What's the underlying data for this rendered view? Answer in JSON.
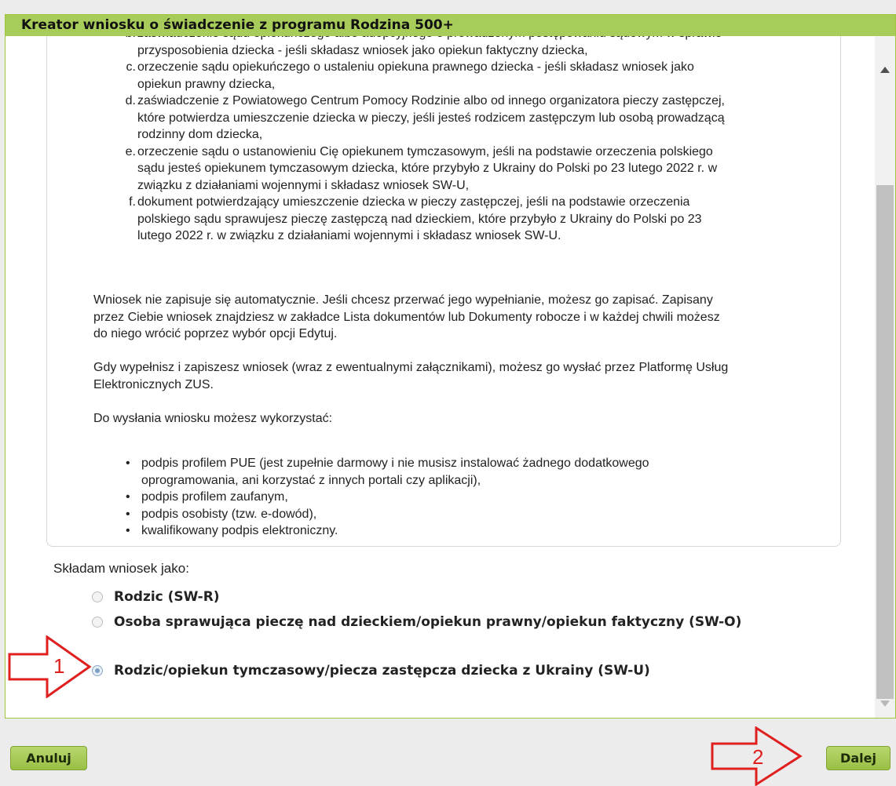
{
  "dialog": {
    "title": "Kreator wniosku o świadczenie z programu Rodzina 500+"
  },
  "documents_list": [
    {
      "letter": "b.",
      "lines": [
        "zaświadczenie sądu opiekuńczego albo adopcyjnego o prowadzonym postępowaniu sądowym w sprawie",
        "przysposobienia dziecka - jeśli składasz wniosek jako opiekun faktyczny dziecka,"
      ]
    },
    {
      "letter": "c.",
      "lines": [
        "orzeczenie sądu opiekuńczego o ustaleniu opiekuna prawnego dziecka - jeśli składasz wniosek jako",
        "opiekun prawny dziecka,"
      ]
    },
    {
      "letter": "d.",
      "lines": [
        "zaświadczenie z Powiatowego Centrum Pomocy Rodzinie albo od innego organizatora pieczy zastępczej,",
        "które potwierdza umieszczenie dziecka w pieczy, jeśli jesteś rodzicem zastępczym lub osobą prowadzącą",
        "rodzinny dom dziecka,"
      ]
    },
    {
      "letter": "e.",
      "lines": [
        "orzeczenie sądu o ustanowieniu Cię opiekunem tymczasowym, jeśli na podstawie orzeczenia polskiego",
        "sądu jesteś opiekunem tymczasowym dziecka, które przybyło z Ukrainy do Polski po 23 lutego 2022 r. w",
        "związku z działaniami wojennymi i składasz wniosek SW-U,"
      ]
    },
    {
      "letter": "f.",
      "lines": [
        "dokument potwierdzający umieszczenie dziecka w pieczy zastępczej, jeśli na podstawie orzeczenia",
        "polskiego sądu sprawujesz pieczę zastępczą nad dzieckiem, które przybyło z Ukrainy do Polski po 23",
        "lutego 2022 r. w związku z działaniami wojennymi i składasz wniosek SW-U."
      ]
    }
  ],
  "paragraphs": {
    "p1": [
      "Wniosek nie zapisuje się automatycznie. Jeśli chcesz przerwać jego wypełnianie, możesz go zapisać. Zapisany",
      "przez Ciebie wniosek znajdziesz w zakładce Lista dokumentów lub Dokumenty robocze i w każdej chwili możesz",
      "do niego wrócić poprzez wybór opcji Edytuj."
    ],
    "p2": [
      "Gdy wypełnisz i zapiszesz wniosek (wraz z ewentualnymi załącznikami), możesz go wysłać przez Platformę Usług",
      "Elektronicznych ZUS."
    ],
    "p3": [
      "Do wysłania wniosku możesz wykorzystać:"
    ]
  },
  "signing_methods": [
    [
      "podpis profilem PUE (jest zupełnie darmowy i nie musisz instalować żadnego dodatkowego",
      "oprogramowania, ani korzystać z innych portali czy aplikacji),"
    ],
    [
      "podpis profilem zaufanym,"
    ],
    [
      "podpis osobisty (tzw. e-dowód),"
    ],
    [
      "kwalifikowany podpis elektroniczny."
    ]
  ],
  "role": {
    "label": "Składam wniosek jako:",
    "options": [
      {
        "label": "Rodzic (SW-R)",
        "selected": false
      },
      {
        "label": "Osoba sprawująca pieczę nad dzieckiem/opiekun prawny/opiekun faktyczny (SW-O)",
        "selected": false
      },
      {
        "label": "Rodzic/opiekun tymczasowy/piecza zastępcza dziecka z Ukrainy (SW-U)",
        "selected": true
      }
    ]
  },
  "buttons": {
    "cancel": "Anuluj",
    "next": "Dalej"
  },
  "annotations": {
    "arrow1": "1",
    "arrow2": "2",
    "color": "#e02020"
  }
}
